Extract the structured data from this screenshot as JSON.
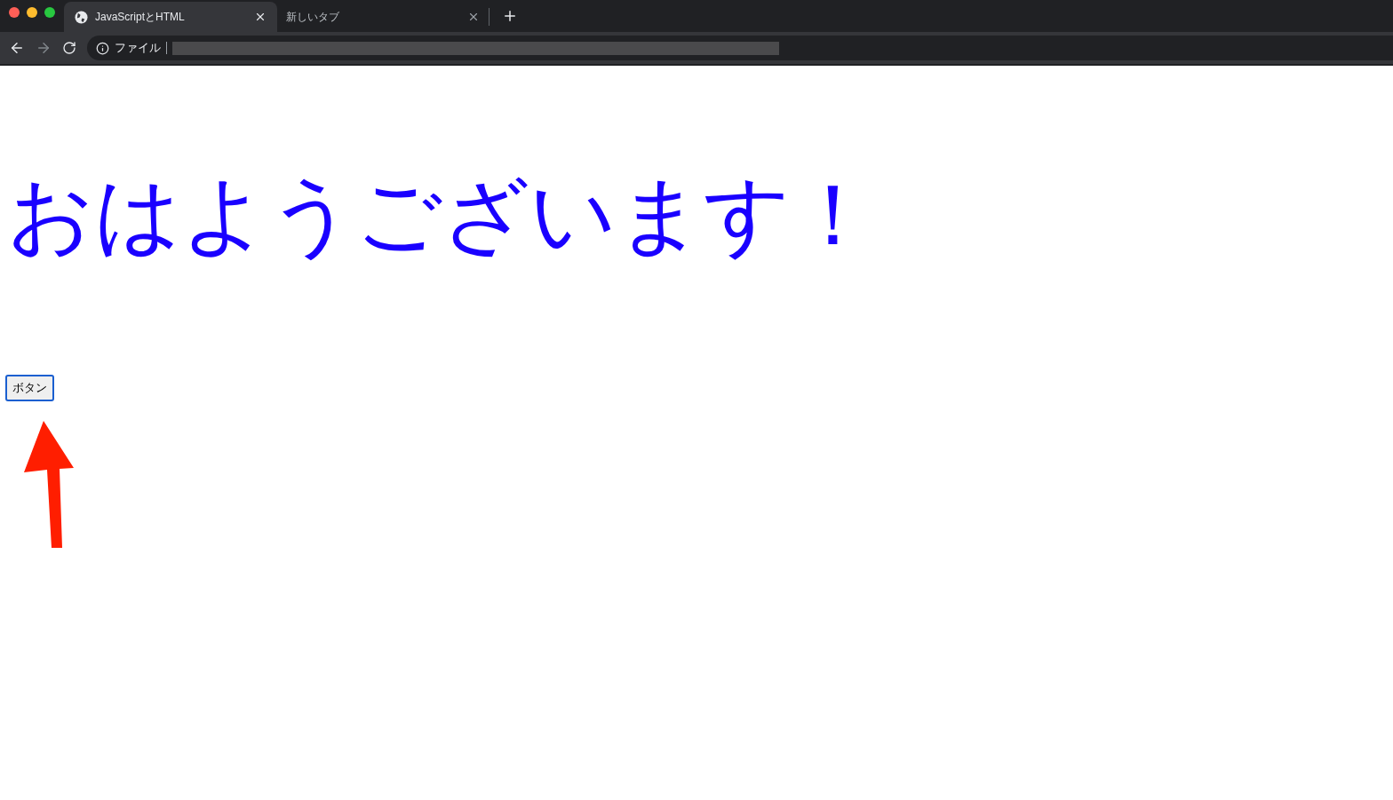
{
  "tabs": [
    {
      "title": "JavaScriptとHTML",
      "selected": true,
      "icon": true
    },
    {
      "title": "新しいタブ",
      "selected": false,
      "icon": false
    }
  ],
  "toolbar": {
    "back_disabled": false,
    "forward_disabled": true,
    "address_label": "ファイル"
  },
  "page": {
    "heading": "おはようございます！",
    "button": {
      "label": "ボタン",
      "focused": true
    }
  }
}
